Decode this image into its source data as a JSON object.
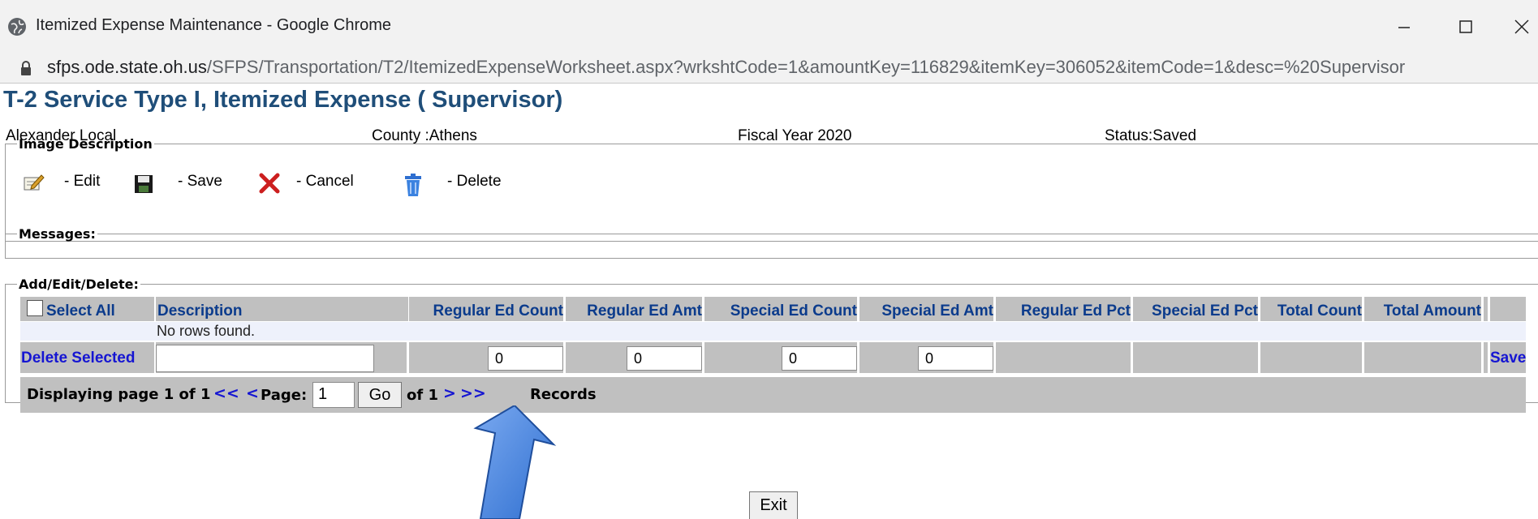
{
  "window": {
    "title": "Itemized Expense Maintenance - Google Chrome",
    "url_host": "sfps.ode.state.oh.us",
    "url_rest": "/SFPS/Transportation/T2/ItemizedExpenseWorksheet.aspx?wrkshtCode=1&amountKey=116829&itemKey=306052&itemCode=1&desc=%20Supervisor"
  },
  "page": {
    "title": "T-2 Service Type I, Itemized Expense ( Supervisor)",
    "district": "Alexander Local",
    "county": "County :Athens",
    "fiscal_year": "Fiscal Year 2020",
    "status": "Status:Saved"
  },
  "image_description": {
    "legend": "Image Description",
    "edit": "- Edit",
    "save": "- Save",
    "cancel": "- Cancel",
    "delete": "- Delete"
  },
  "messages": {
    "legend": "Messages:"
  },
  "add_edit_delete": {
    "legend": "Add/Edit/Delete:",
    "columns": {
      "select_all": "Select All",
      "description": "Description",
      "reg_count": "Regular Ed Count",
      "reg_amt": "Regular Ed Amt",
      "spec_count": "Special Ed Count",
      "spec_amt": "Special Ed Amt",
      "reg_pct": "Regular Ed Pct",
      "spec_pct": "Special Ed Pct",
      "total_count": "Total Count",
      "total_amount": "Total Amount"
    },
    "no_rows": "No rows found.",
    "delete_selected": "Delete Selected",
    "inputs": {
      "description": "",
      "reg_count": "0",
      "reg_amt": "0",
      "spec_count": "0",
      "spec_amt": "0"
    },
    "save_link": "Save"
  },
  "pager": {
    "displaying": "Displaying page 1 of 1",
    "first": "<<",
    "prev": "<",
    "page_label": "Page:",
    "page_value": "1",
    "go": "Go",
    "of": "of 1",
    "next": ">",
    "last": ">>",
    "records_suffix": "Records"
  },
  "exit": "Exit",
  "colors": {
    "title_blue": "#1f4e79",
    "link_blue": "#1515d2",
    "grid_gray": "#c0c0c0",
    "arrow_blue": "#4a86e8"
  }
}
